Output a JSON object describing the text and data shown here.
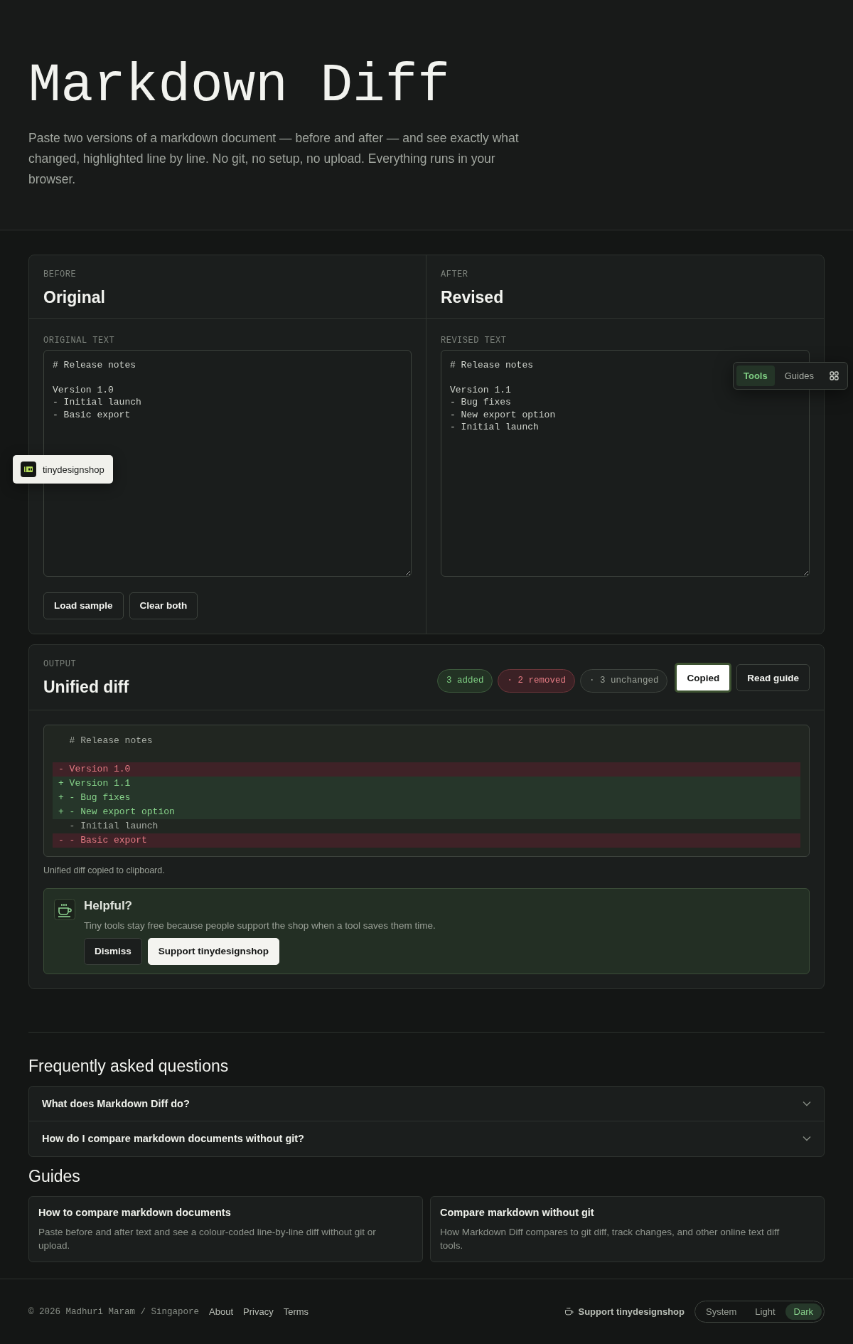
{
  "hero": {
    "title": "Markdown Diff",
    "description": "Paste two versions of a markdown document — before and after — and see exactly what changed, highlighted line by line. No git, no setup, no upload. Everything runs in your browser."
  },
  "editors": [
    {
      "eyebrow": "BEFORE",
      "title": "Original",
      "field_label": "ORIGINAL TEXT",
      "value": "# Release notes\n\nVersion 1.0\n- Initial launch\n- Basic export"
    },
    {
      "eyebrow": "AFTER",
      "title": "Revised",
      "field_label": "REVISED TEXT",
      "value": "# Release notes\n\nVersion 1.1\n- Bug fixes\n- New export option\n- Initial launch"
    }
  ],
  "editor_buttons": [
    "Load sample",
    "Clear both"
  ],
  "output": {
    "eyebrow": "OUTPUT",
    "title": "Unified diff",
    "stats": [
      {
        "kind": "added",
        "text": "3 added"
      },
      {
        "kind": "removed",
        "text": "· 2 removed"
      },
      {
        "kind": "unchanged",
        "text": "· 3 unchanged"
      }
    ],
    "buttons": [
      {
        "label": "Copied",
        "kind": "primary"
      },
      {
        "label": "Read guide",
        "kind": "secondary"
      }
    ],
    "diff": [
      {
        "kind": "context",
        "text": "  # Release notes"
      },
      {
        "kind": "blank"
      },
      {
        "kind": "removed",
        "text": "- Version 1.0"
      },
      {
        "kind": "added",
        "text": "+ Version 1.1"
      },
      {
        "kind": "added",
        "text": "+ - Bug fixes"
      },
      {
        "kind": "added",
        "text": "+ - New export option"
      },
      {
        "kind": "context",
        "text": "  - Initial launch"
      },
      {
        "kind": "removed",
        "text": "- - Basic export"
      }
    ],
    "status": "Unified diff copied to clipboard.",
    "helpful": {
      "title": "Helpful?",
      "text": "Tiny tools stay free because people support the shop when a tool saves them time.",
      "buttons": [
        {
          "label": "Dismiss",
          "kind": "secondary"
        },
        {
          "label": "Support tinydesignshop",
          "kind": "primary"
        }
      ]
    }
  },
  "faq": {
    "title": "Frequently asked questions",
    "items": [
      {
        "question": "What does Markdown Diff do?",
        "expanded": false
      },
      {
        "question": "How do I compare markdown documents without git?",
        "expanded": false
      }
    ]
  },
  "guides": {
    "title": "Guides",
    "items": [
      {
        "title": "How to compare markdown documents",
        "text": "Paste before and after text and see a colour-coded line-by-line diff without git or upload."
      },
      {
        "title": "Compare markdown without git",
        "text": "How Markdown Diff compares to git diff, track changes, and other online text diff tools."
      }
    ]
  },
  "footer": {
    "copyright": "© 2026 Madhuri Maram / Singapore",
    "links": [
      "About",
      "Privacy",
      "Terms"
    ],
    "support": "Support tinydesignshop",
    "themes": [
      {
        "label": "System",
        "selected": false
      },
      {
        "label": "Light",
        "selected": false
      },
      {
        "label": "Dark",
        "selected": true
      }
    ]
  },
  "shop_badge": {
    "label": "tinydesignshop"
  },
  "site_nav": {
    "tabs": [
      {
        "label": "Tools",
        "selected": true
      },
      {
        "label": "Guides",
        "selected": false
      }
    ]
  }
}
